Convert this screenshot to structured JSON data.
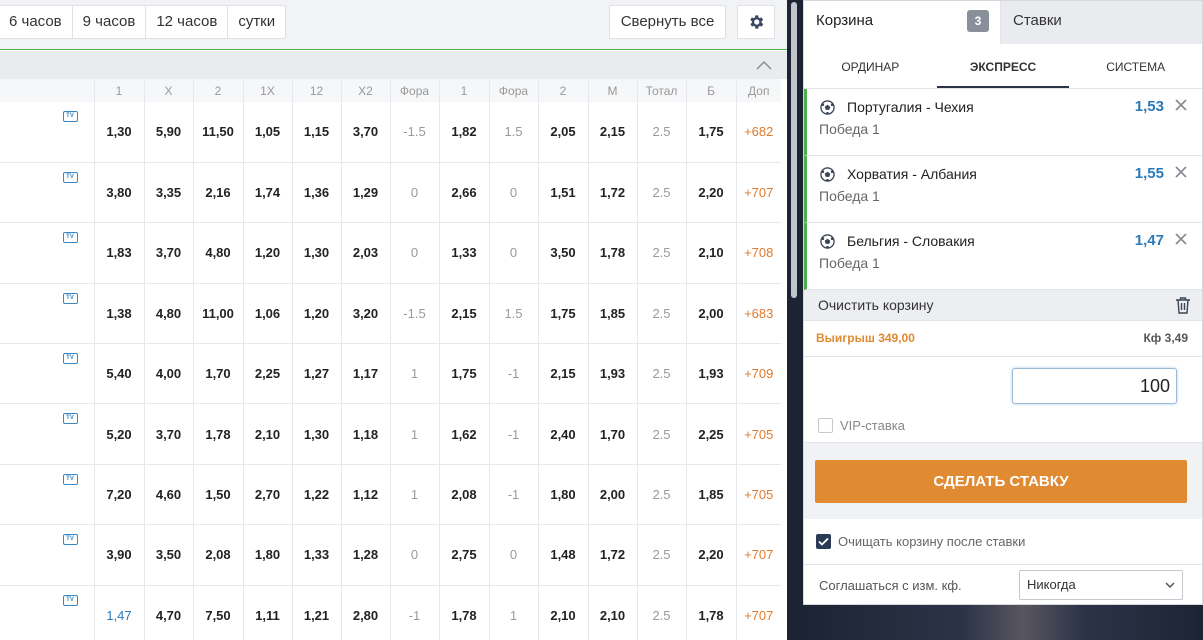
{
  "toolbar": {
    "periods": [
      "6 часов",
      "9 часов",
      "12 часов",
      "сутки"
    ],
    "collapse_label": "Свернуть все"
  },
  "table": {
    "headers": [
      "1",
      "X",
      "2",
      "1X",
      "12",
      "X2",
      "Фора",
      "1",
      "Фора",
      "2",
      "М",
      "Тотал",
      "Б",
      "Доп"
    ],
    "rows": [
      [
        "1,30",
        "5,90",
        "11,50",
        "1,05",
        "1,15",
        "3,70",
        "-1.5",
        "1,82",
        "1.5",
        "2,05",
        "2,15",
        "2.5",
        "1,75",
        "+682"
      ],
      [
        "3,80",
        "3,35",
        "2,16",
        "1,74",
        "1,36",
        "1,29",
        "0",
        "2,66",
        "0",
        "1,51",
        "1,72",
        "2.5",
        "2,20",
        "+707"
      ],
      [
        "1,83",
        "3,70",
        "4,80",
        "1,20",
        "1,30",
        "2,03",
        "0",
        "1,33",
        "0",
        "3,50",
        "1,78",
        "2.5",
        "2,10",
        "+708"
      ],
      [
        "1,38",
        "4,80",
        "11,00",
        "1,06",
        "1,20",
        "3,20",
        "-1.5",
        "2,15",
        "1.5",
        "1,75",
        "1,85",
        "2.5",
        "2,00",
        "+683"
      ],
      [
        "5,40",
        "4,00",
        "1,70",
        "2,25",
        "1,27",
        "1,17",
        "1",
        "1,75",
        "-1",
        "2,15",
        "1,93",
        "2.5",
        "1,93",
        "+709"
      ],
      [
        "5,20",
        "3,70",
        "1,78",
        "2,10",
        "1,30",
        "1,18",
        "1",
        "1,62",
        "-1",
        "2,40",
        "1,70",
        "2.5",
        "2,25",
        "+705"
      ],
      [
        "7,20",
        "4,60",
        "1,50",
        "2,70",
        "1,22",
        "1,12",
        "1",
        "2,08",
        "-1",
        "1,80",
        "2,00",
        "2.5",
        "1,85",
        "+705"
      ],
      [
        "3,90",
        "3,50",
        "2,08",
        "1,80",
        "1,33",
        "1,28",
        "0",
        "2,75",
        "0",
        "1,48",
        "1,72",
        "2.5",
        "2,20",
        "+707"
      ],
      [
        "1,47",
        "4,70",
        "7,50",
        "1,11",
        "1,21",
        "2,80",
        "-1",
        "1,78",
        "1",
        "2,10",
        "2,10",
        "2.5",
        "1,78",
        "+707"
      ]
    ],
    "tv_label": "TV"
  },
  "slip": {
    "tab_cart": "Корзина",
    "cart_count": "3",
    "tab_bets": "Ставки",
    "types": [
      "ОРДИНАР",
      "ЭКСПРЕСС",
      "СИСТЕМА"
    ],
    "active_type": "ЭКСПРЕСС",
    "bets": [
      {
        "match": "Португалия - Чехия",
        "outcome": "Победа 1",
        "odd": "1,53"
      },
      {
        "match": "Хорватия - Албания",
        "outcome": "Победа 1",
        "odd": "1,55"
      },
      {
        "match": "Бельгия - Словакия",
        "outcome": "Победа 1",
        "odd": "1,47"
      }
    ],
    "clear_label": "Очистить корзину",
    "win_label": "Выигрыш 349,00",
    "coef_label": "Кф 3,49",
    "amount": "100",
    "vip_label": "VIP-ставка",
    "place_label": "СДЕЛАТЬ СТАВКУ",
    "clear_after_label": "Очищать корзину после ставки",
    "agree_label": "Соглашаться с изм. кф.",
    "agree_value": "Никогда"
  },
  "colors": {
    "accent_orange": "#e08a32",
    "odd_blue": "#2b7ab8",
    "active_green": "#4caf50",
    "dark_bg": "#1c2434"
  }
}
